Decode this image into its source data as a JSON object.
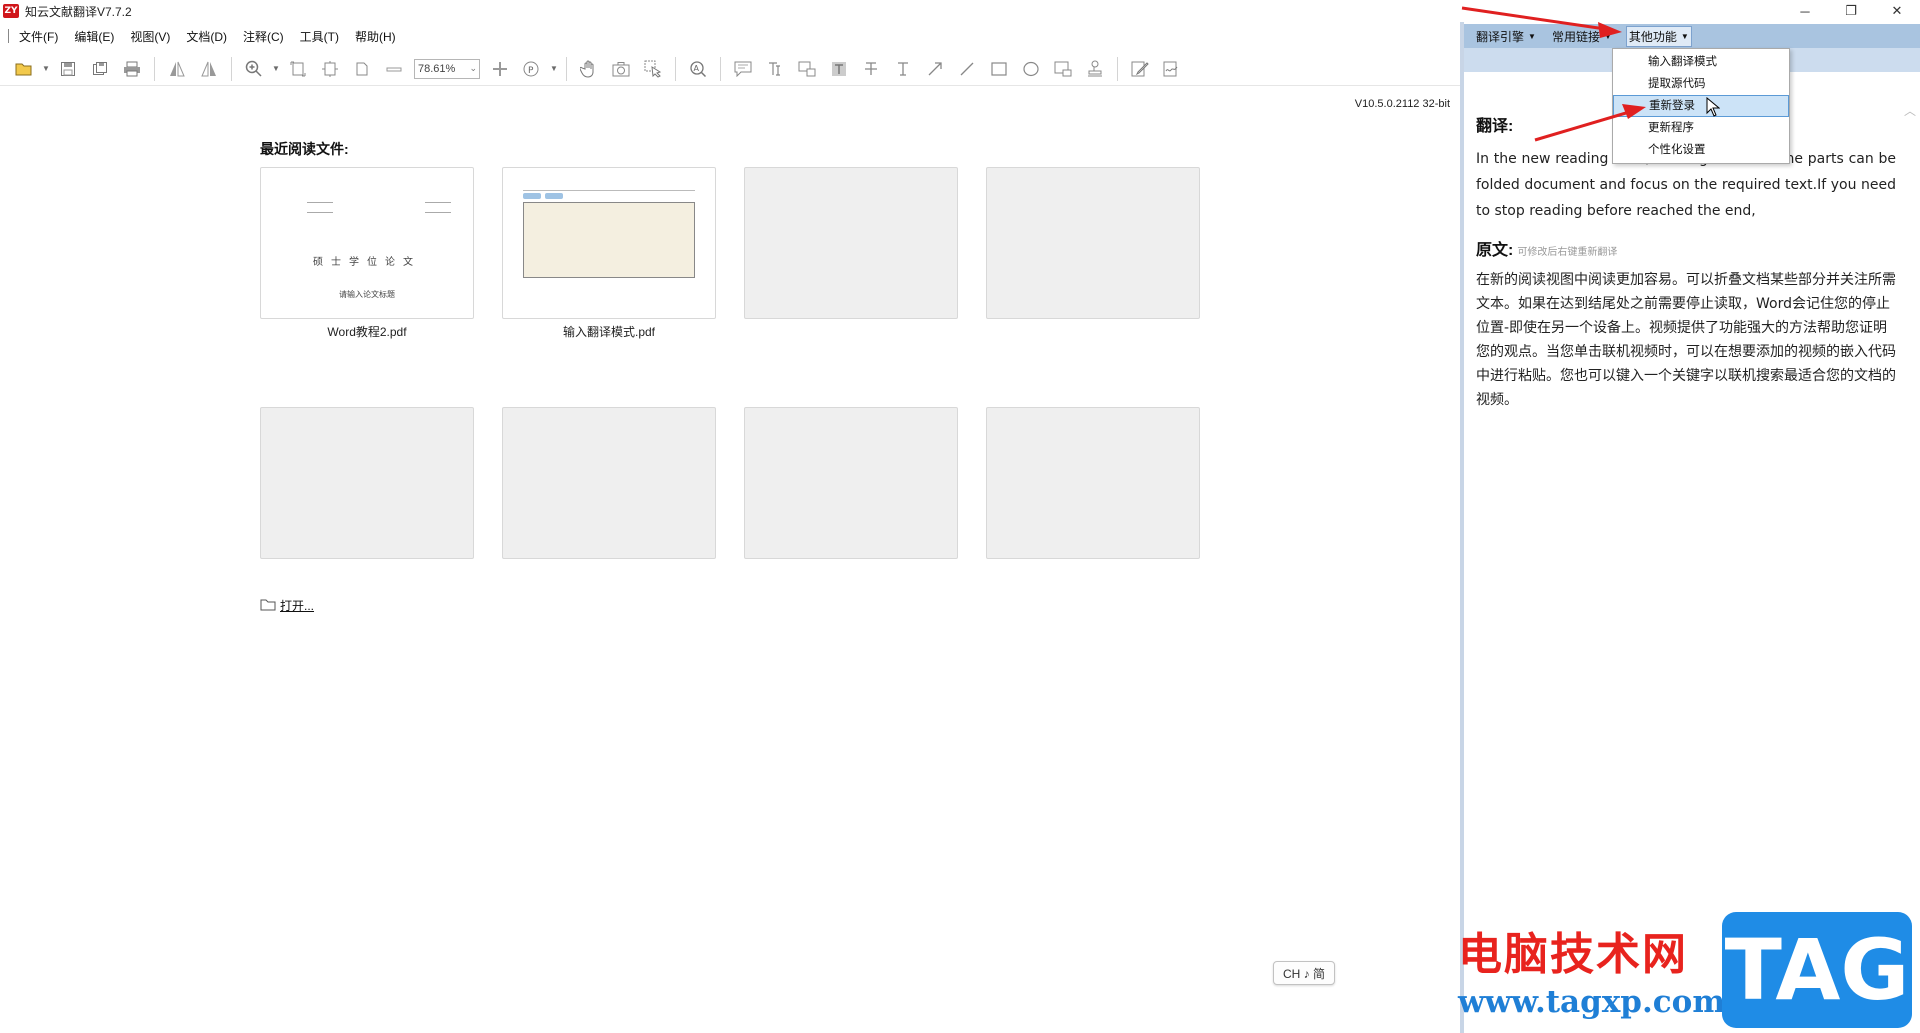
{
  "window": {
    "title": "知云文献翻译V7.7.2",
    "logo": "ZY",
    "controls": [
      "─",
      "❐",
      "✕"
    ]
  },
  "menubar": {
    "items": [
      "文件(F)",
      "编辑(E)",
      "视图(V)",
      "文档(D)",
      "注释(C)",
      "工具(T)",
      "帮助(H)"
    ]
  },
  "toolbar": {
    "zoom_value": "78.61%",
    "icons": [
      "open-folder-icon",
      "save-icon",
      "save-all-icon",
      "print-icon",
      "rotate-left-icon",
      "rotate-right-icon",
      "zoom-in-icon",
      "fit-page-icon",
      "fit-width-icon",
      "actual-size-icon",
      "zoom-out-icon",
      "page-icon",
      "hand-icon",
      "snapshot-icon",
      "select-icon",
      "find-icon",
      "note-icon",
      "text-select-icon",
      "image-select-icon",
      "highlight-icon",
      "strikeout-icon",
      "typewriter-icon",
      "arrow-icon",
      "line-icon",
      "rectangle-icon",
      "ellipse-icon",
      "stamp-image-icon",
      "stamp-icon",
      "edit-icon",
      "sign-icon"
    ]
  },
  "main": {
    "version": "V10.5.0.2112 32-bit",
    "recent_title": "最近阅读文件:",
    "files": [
      {
        "name": "Word教程2.pdf",
        "heading": "硕士学位论文",
        "subheading": "请输入论文标题"
      },
      {
        "name": "输入翻译模式.pdf"
      }
    ],
    "open_label": "打开..."
  },
  "panel": {
    "toolbar": {
      "engine": "翻译引擎",
      "links": "常用链接",
      "other": "其他功能"
    },
    "dropdown": [
      "输入翻译模式",
      "提取源代码",
      "重新登录",
      "更新程序",
      "个性化设置"
    ],
    "translation_head": "翻译:",
    "translation_text": "In the new reading view, reading easier. Some parts can be folded document and focus on the required text.If you need to stop reading before reached the end,",
    "original_head": "原文:",
    "original_hint": "可修改后右键重新翻译",
    "original_text": "在新的阅读视图中阅读更加容易。可以折叠文档某些部分并关注所需文本。如果在达到结尾处之前需要停止读取，Word会记住您的停止位置-即使在另一个设备上。视频提供了功能强大的方法帮助您证明您的观点。当您单击联机视频时，可以在想要添加的视频的嵌入代码中进行粘贴。您也可以键入一个关键字以联机搜索最适合您的文档的视频。"
  },
  "ime": "CH ♪ 简",
  "watermark": {
    "cn": "电脑技术网",
    "url": "www.tagxp.com",
    "tag": "TAG"
  },
  "colors": {
    "panel_toolbar": "#a9c4e0",
    "highlight": "#cce3f7",
    "annotation_arrow": "#e02020"
  }
}
